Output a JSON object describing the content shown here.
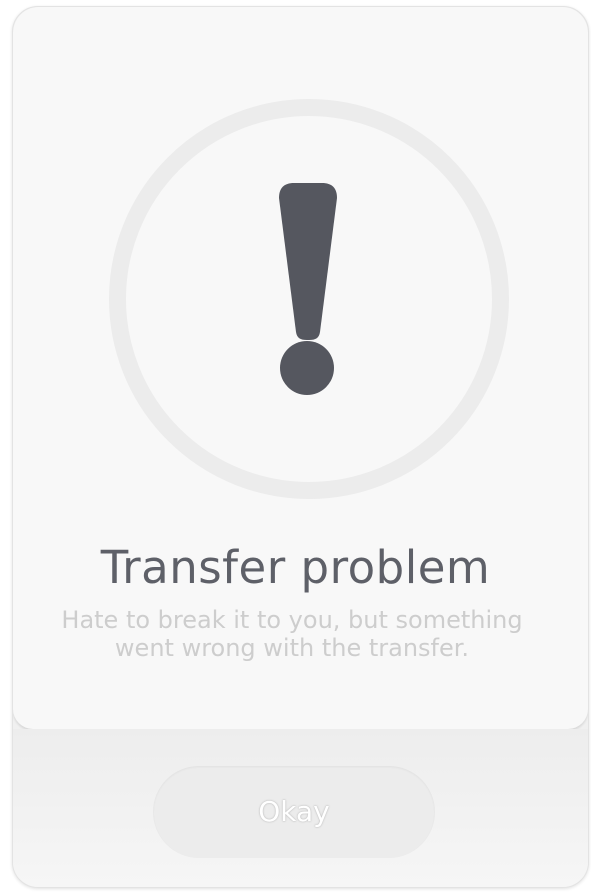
{
  "dialog": {
    "icon": "exclamation-icon",
    "title": "Transfer problem",
    "message": "Hate to break it to you, but something went wrong with the transfer.",
    "button_label": "Okay"
  },
  "colors": {
    "icon": "#55575f",
    "title": "#5e6068",
    "message": "#cdcdcd",
    "ring": "#ececec"
  }
}
